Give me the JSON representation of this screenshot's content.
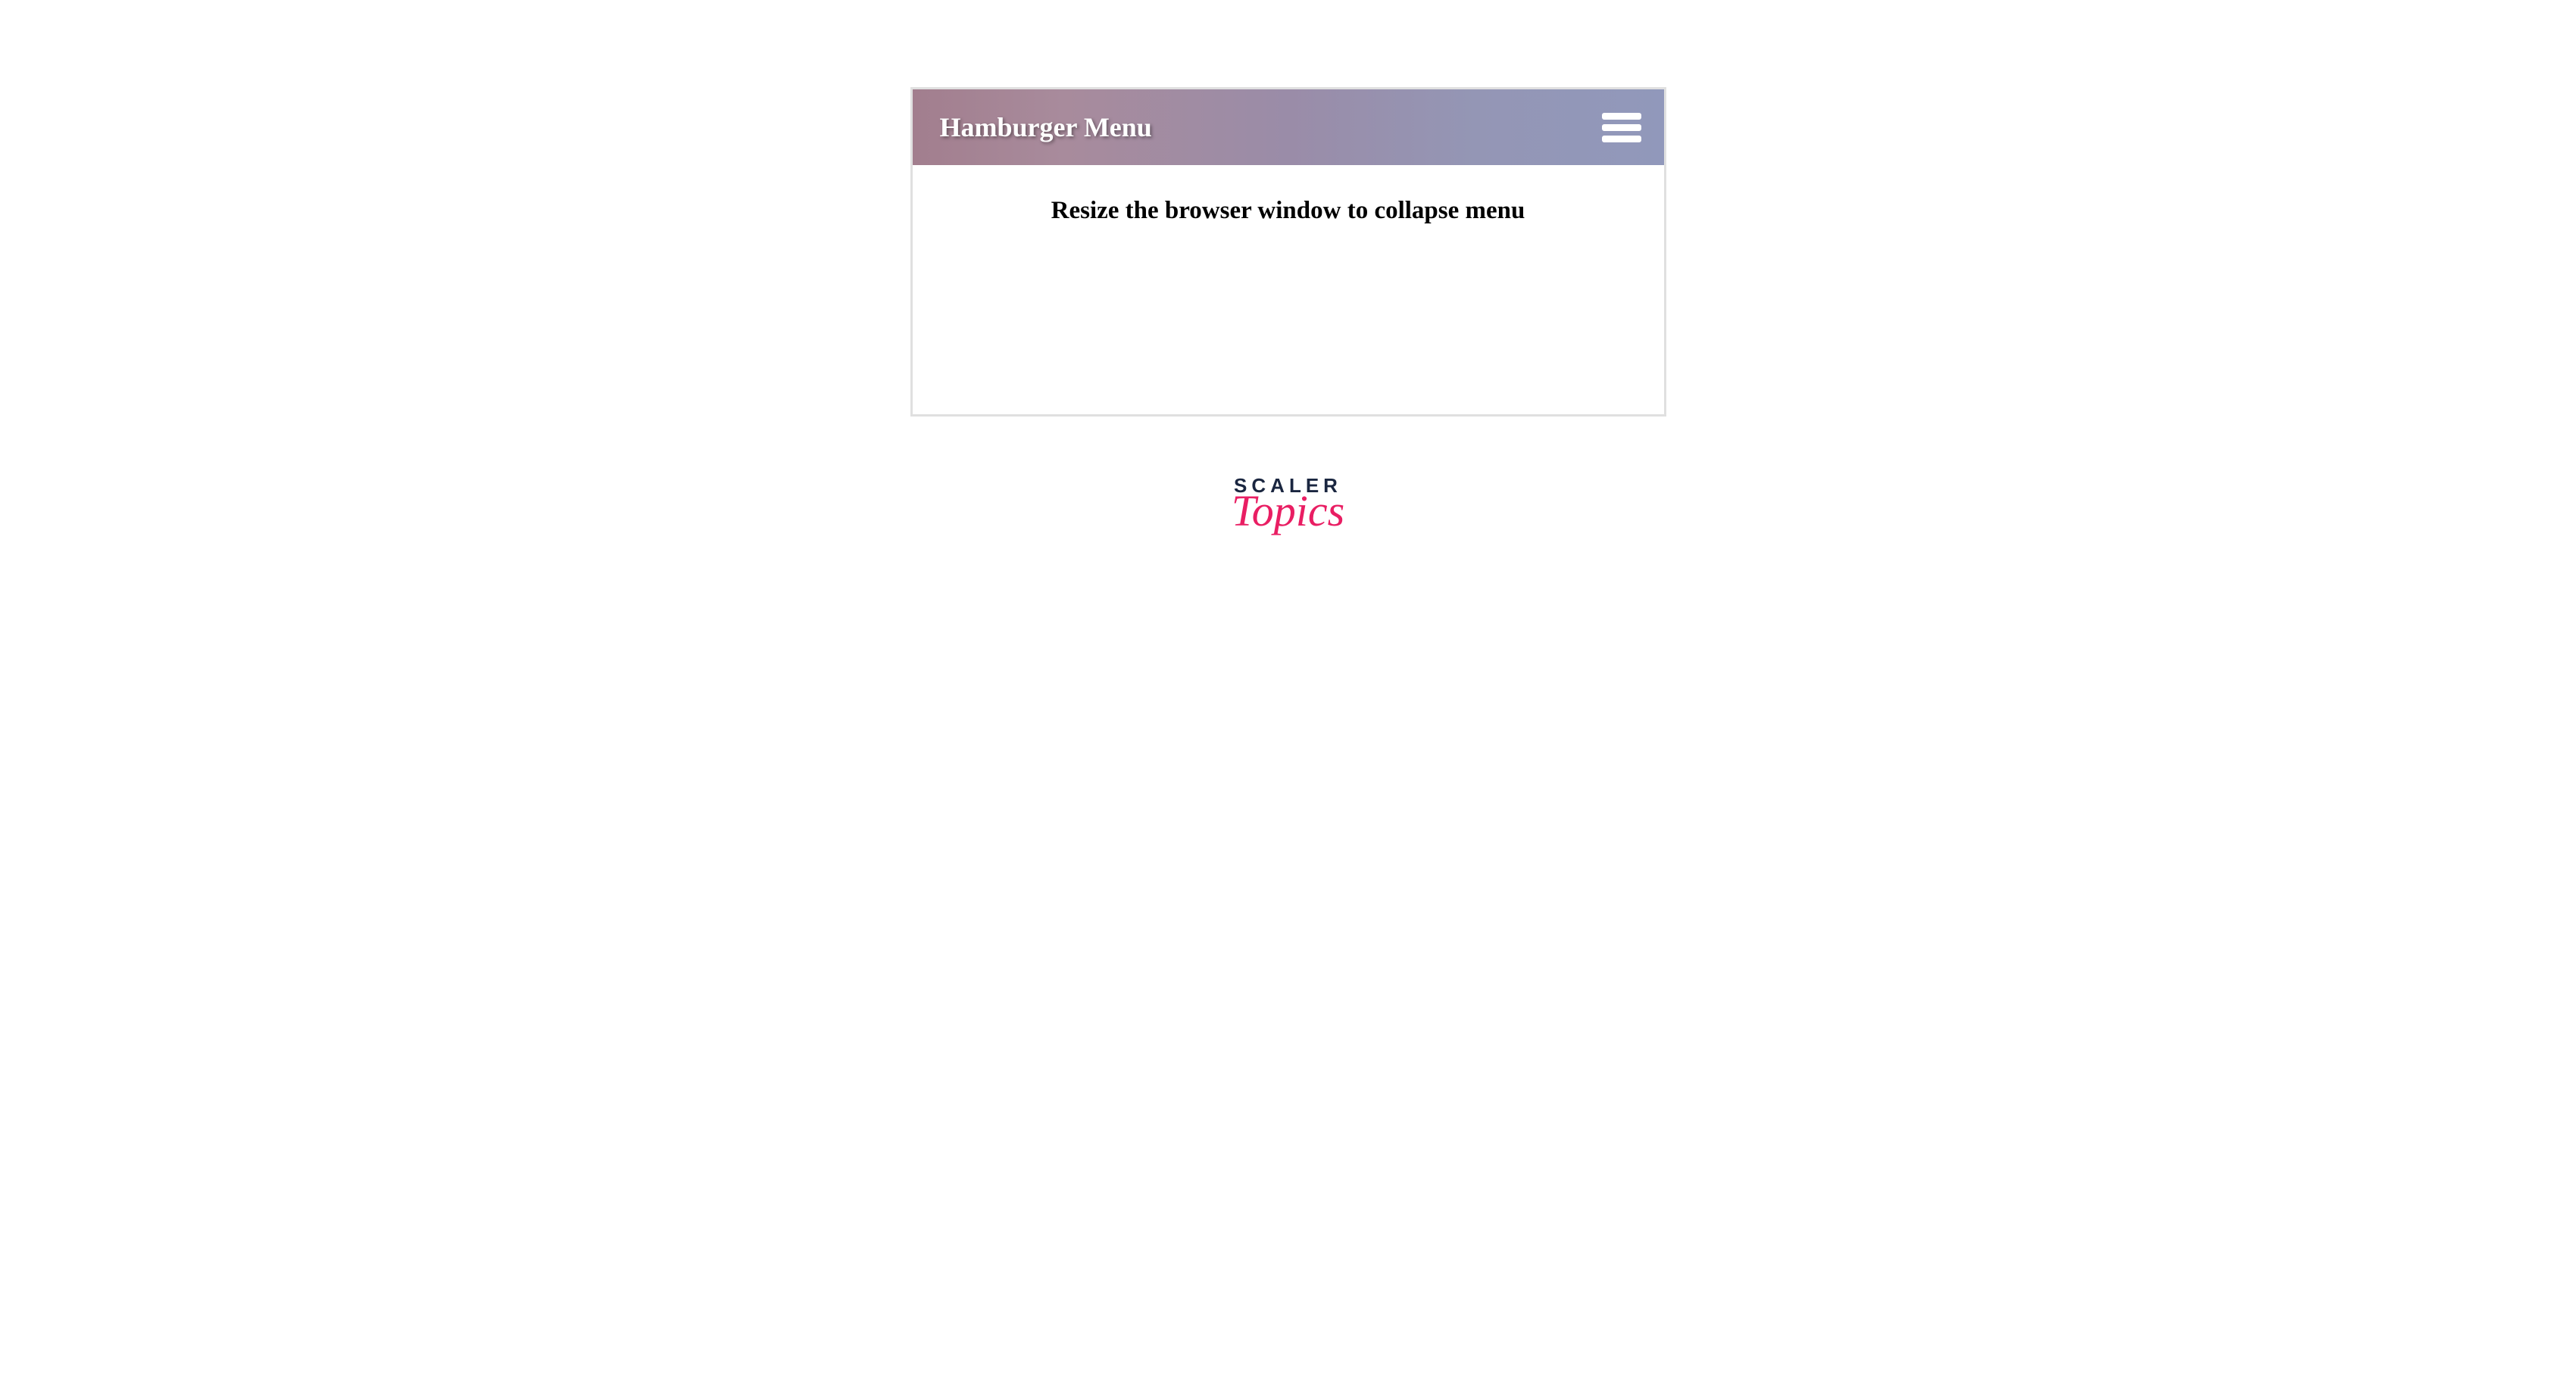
{
  "navbar": {
    "title": "Hamburger Menu"
  },
  "content": {
    "heading": "Resize the browser window to collapse menu"
  },
  "logo": {
    "top_text": "SCALER",
    "bottom_text": "Topics"
  },
  "colors": {
    "navbar_gradient_start": "#a27e8e",
    "navbar_gradient_end": "#9198bb",
    "hamburger_bar": "#ffffff",
    "logo_scaler": "#1a2640",
    "logo_topics": "#e91e63"
  }
}
